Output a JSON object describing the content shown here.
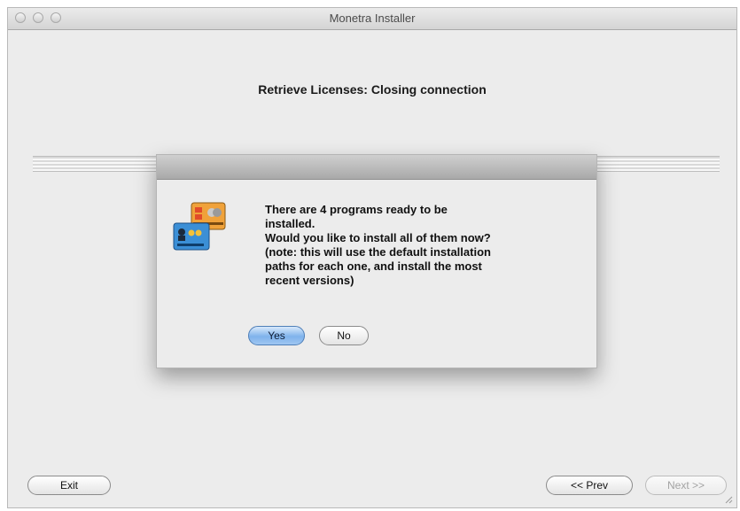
{
  "window": {
    "title": "Monetra Installer"
  },
  "main": {
    "heading": "Retrieve Licenses: Closing connection"
  },
  "dialog": {
    "message_lines": [
      "There are 4 programs ready to be",
      "installed.",
      "Would you like to install all of them now?",
      "(note: this will use the default installation",
      "paths for each one, and install the most",
      "recent versions)"
    ],
    "yes_label": "Yes",
    "no_label": "No",
    "icon": "credit-cards-icon"
  },
  "footer": {
    "exit_label": "Exit",
    "prev_label": "<< Prev",
    "next_label": "Next >>"
  },
  "colors": {
    "window_bg": "#ececec",
    "default_button": "#7fb3ec",
    "disabled_text": "#a3a3a3"
  }
}
